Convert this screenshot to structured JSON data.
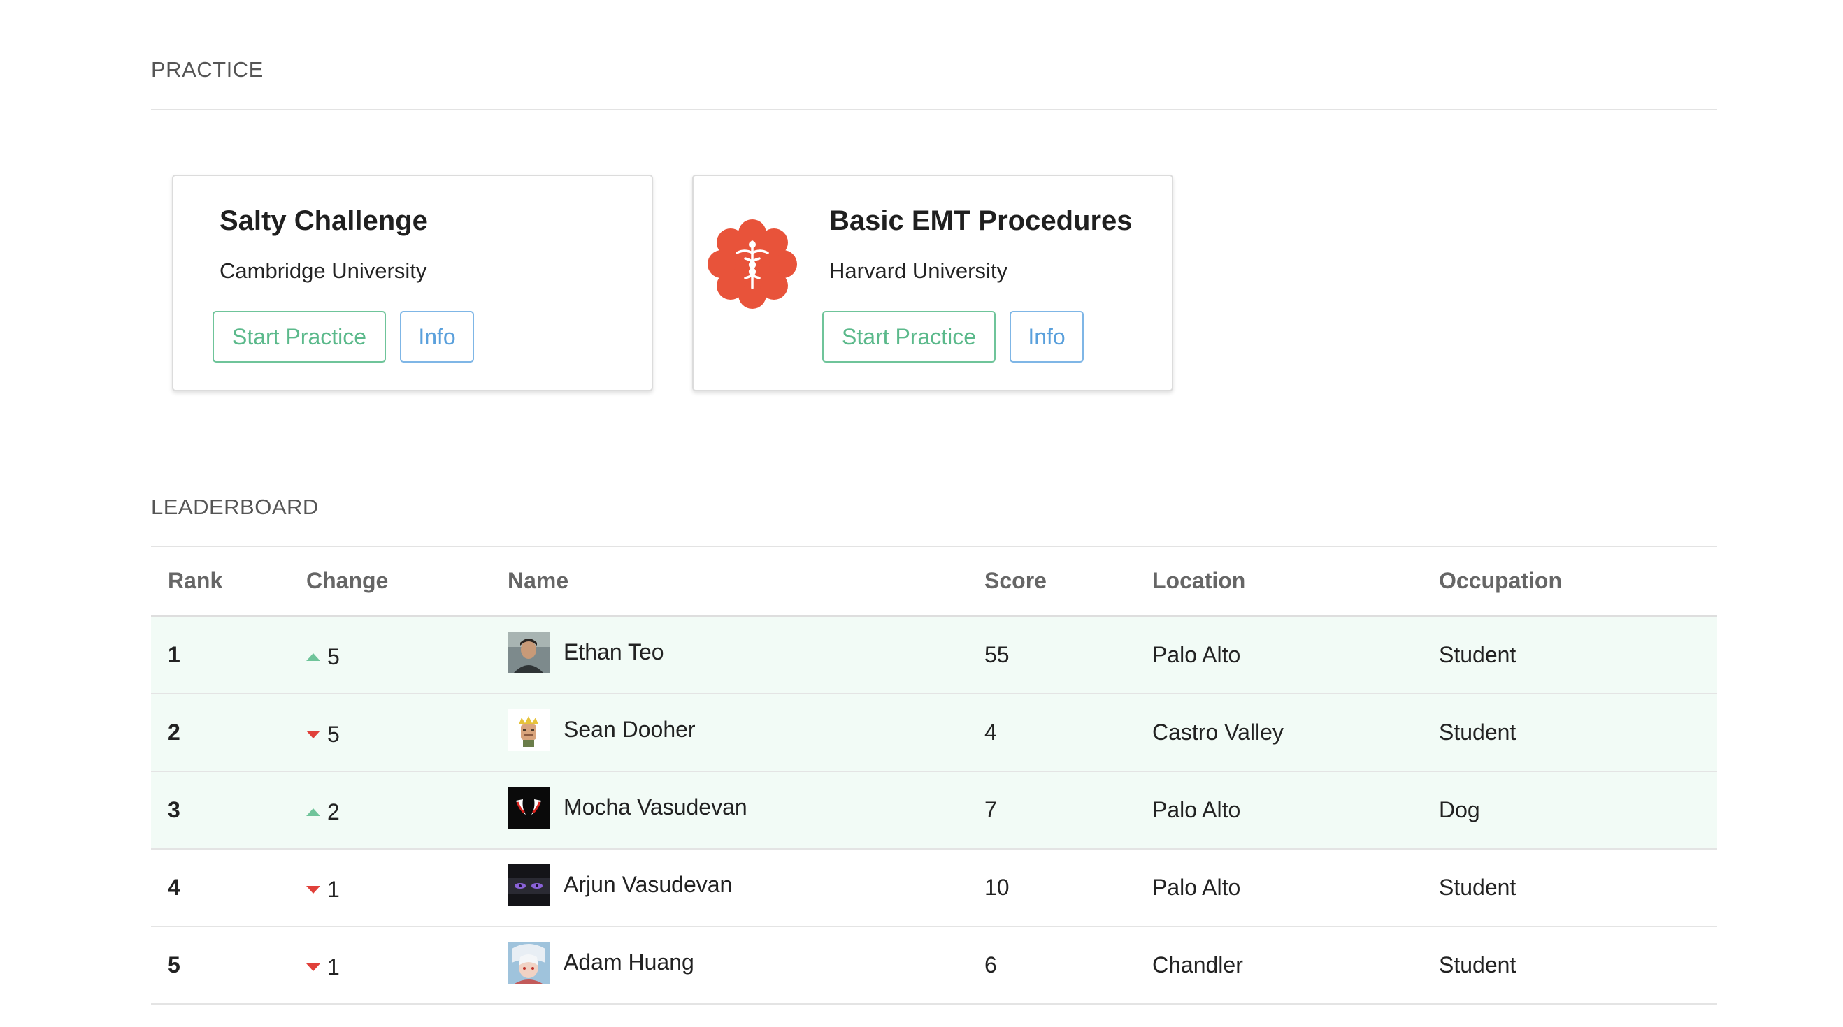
{
  "practice": {
    "heading": "PRACTICE",
    "cards": [
      {
        "title": "Salty Challenge",
        "org": "Cambridge University",
        "start_label": "Start Practice",
        "info_label": "Info"
      },
      {
        "title": "Basic EMT Procedures",
        "org": "Harvard University",
        "start_label": "Start Practice",
        "info_label": "Info",
        "icon": "medical-caduceus-icon"
      }
    ]
  },
  "leaderboard": {
    "heading": "LEADERBOARD",
    "columns": {
      "rank": "Rank",
      "change": "Change",
      "name": "Name",
      "score": "Score",
      "location": "Location",
      "occupation": "Occupation"
    },
    "rows": [
      {
        "rank": "1",
        "direction": "up",
        "change": "5",
        "name": "Ethan Teo",
        "score": "55",
        "location": "Palo Alto",
        "occupation": "Student"
      },
      {
        "rank": "2",
        "direction": "down",
        "change": "5",
        "name": "Sean Dooher",
        "score": "4",
        "location": "Castro Valley",
        "occupation": "Student"
      },
      {
        "rank": "3",
        "direction": "up",
        "change": "2",
        "name": "Mocha Vasudevan",
        "score": "7",
        "location": "Palo Alto",
        "occupation": "Dog"
      },
      {
        "rank": "4",
        "direction": "down",
        "change": "1",
        "name": "Arjun Vasudevan",
        "score": "10",
        "location": "Palo Alto",
        "occupation": "Student"
      },
      {
        "rank": "5",
        "direction": "down",
        "change": "1",
        "name": "Adam Huang",
        "score": "6",
        "location": "Chandler",
        "occupation": "Student"
      }
    ]
  },
  "colors": {
    "accent_green": "#6fc49a",
    "accent_blue": "#5aa0dc",
    "down_red": "#e0403a",
    "icon_red": "#e8533a",
    "highlight_row": "#f2fbf6"
  }
}
